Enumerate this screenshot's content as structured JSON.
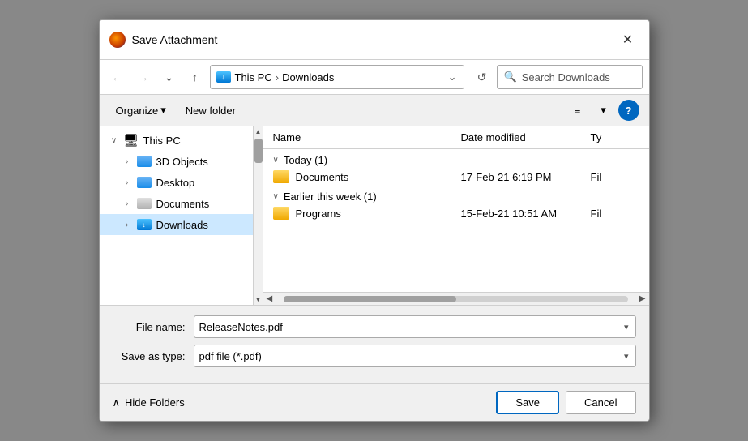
{
  "title_bar": {
    "title": "Save Attachment",
    "close_label": "✕"
  },
  "toolbar": {
    "back_label": "←",
    "forward_label": "→",
    "dropdown_label": "⌄",
    "up_label": "↑",
    "path": {
      "icon": "downloads-folder",
      "parts": [
        "This PC",
        "Downloads"
      ]
    },
    "path_dropdown": "⌄",
    "refresh_label": "↺",
    "search_placeholder": "Search Downloads",
    "search_icon": "🔍"
  },
  "action_bar": {
    "organize_label": "Organize",
    "organize_arrow": "▾",
    "new_folder_label": "New folder",
    "view_icon": "≡",
    "view_arrow": "▾",
    "help_label": "?"
  },
  "sidebar": {
    "items": [
      {
        "id": "this-pc",
        "label": "This PC",
        "arrow": "∨",
        "icon": "pc",
        "level": 0
      },
      {
        "id": "3d-objects",
        "label": "3D Objects",
        "arrow": ">",
        "icon": "folder-blue",
        "level": 1
      },
      {
        "id": "desktop",
        "label": "Desktop",
        "arrow": ">",
        "icon": "folder-blue",
        "level": 1
      },
      {
        "id": "documents",
        "label": "Documents",
        "arrow": ">",
        "icon": "folder-gray",
        "level": 1
      },
      {
        "id": "downloads",
        "label": "Downloads",
        "arrow": ">",
        "icon": "folder-download",
        "level": 1,
        "active": true
      }
    ]
  },
  "file_list": {
    "columns": {
      "name": "Name",
      "date_modified": "Date modified",
      "type": "Ty"
    },
    "groups": [
      {
        "label": "Today (1)",
        "expanded": true,
        "items": [
          {
            "name": "Documents",
            "date": "17-Feb-21 6:19 PM",
            "type": "Fil"
          }
        ]
      },
      {
        "label": "Earlier this week (1)",
        "expanded": true,
        "items": [
          {
            "name": "Programs",
            "date": "15-Feb-21 10:51 AM",
            "type": "Fil"
          }
        ]
      }
    ]
  },
  "form": {
    "file_name_label": "File name:",
    "file_name_value": "ReleaseNotes.pdf",
    "file_type_label": "Save as type:",
    "file_type_value": "pdf file (*.pdf)"
  },
  "bottom_bar": {
    "hide_folders_label": "Hide Folders",
    "hide_folders_arrow": "∧",
    "save_label": "Save",
    "cancel_label": "Cancel"
  }
}
